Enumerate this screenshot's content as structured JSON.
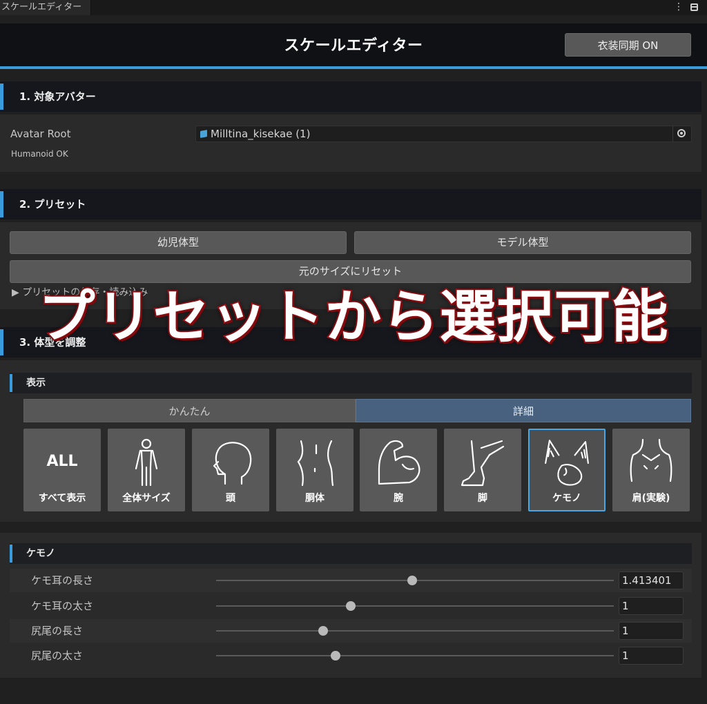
{
  "window": {
    "tab_title": "スケールエディター"
  },
  "header": {
    "title": "スケールエディター",
    "sync_button": "衣装同期 ON"
  },
  "section1": {
    "title": "1. 対象アバター",
    "avatar_root_label": "Avatar Root",
    "avatar_value": "Milltina_kisekae (1)",
    "status": "Humanoid OK"
  },
  "section2": {
    "title": "2. プリセット",
    "buttons": [
      "幼児体型",
      "モデル体型"
    ],
    "reset_button": "元のサイズにリセット",
    "foldout": "▶ プリセットの保存・読み込み"
  },
  "overlay_caption": "プリセットから選択可能",
  "section3": {
    "title": "3. 体型を調整",
    "display_header": "表示",
    "mode_tabs": [
      "かんたん",
      "詳細"
    ],
    "selected_mode": "詳細",
    "categories": [
      {
        "label": "すべて表示",
        "icon": "all-text-icon",
        "icon_text": "ALL"
      },
      {
        "label": "全体サイズ",
        "icon": "full-body-icon"
      },
      {
        "label": "頭",
        "icon": "head-icon"
      },
      {
        "label": "胴体",
        "icon": "torso-icon"
      },
      {
        "label": "腕",
        "icon": "arm-icon"
      },
      {
        "label": "脚",
        "icon": "leg-icon"
      },
      {
        "label": "ケモノ",
        "icon": "kemono-icon"
      },
      {
        "label": "肩(実験)",
        "icon": "shoulder-icon"
      }
    ],
    "selected_category": "ケモノ"
  },
  "kemono": {
    "header": "ケモノ",
    "sliders": [
      {
        "label": "ケモ耳の長さ",
        "value": "1.413401",
        "fraction": 0.493
      },
      {
        "label": "ケモ耳の太さ",
        "value": "1",
        "fraction": 0.338
      },
      {
        "label": "尻尾の長さ",
        "value": "1",
        "fraction": 0.269
      },
      {
        "label": "尻尾の太さ",
        "value": "1",
        "fraction": 0.3
      }
    ]
  },
  "colors": {
    "accent": "#3a9bdc",
    "overlay_stroke": "#b3141a",
    "selected_tab": "#48617f"
  }
}
